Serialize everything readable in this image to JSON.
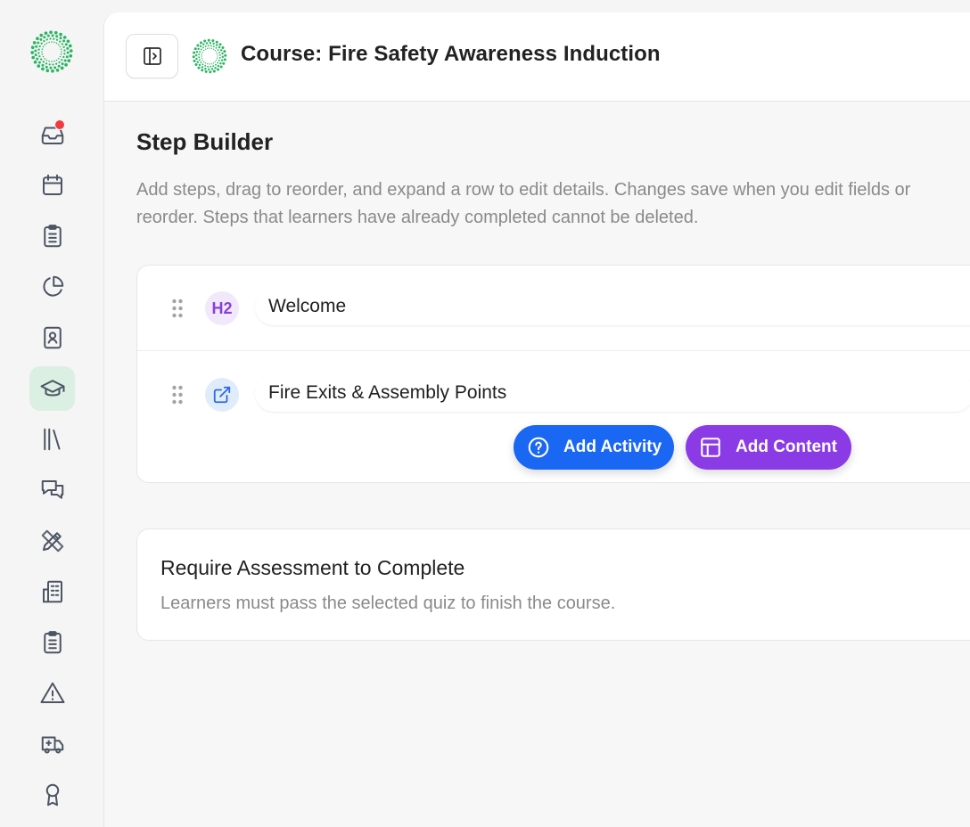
{
  "sidebar": {
    "logo": "sparkle-ring-logo",
    "items": [
      {
        "icon": "inbox-icon",
        "badge": true
      },
      {
        "icon": "calendar-icon"
      },
      {
        "icon": "clipboard-list-icon"
      },
      {
        "icon": "pie-chart-icon"
      },
      {
        "icon": "contact-book-icon"
      },
      {
        "icon": "graduation-cap-icon",
        "active": true
      },
      {
        "icon": "library-icon"
      },
      {
        "icon": "messages-icon"
      },
      {
        "icon": "pencil-ruler-icon"
      },
      {
        "icon": "building-icon"
      },
      {
        "icon": "clipboard-checklist-icon"
      },
      {
        "icon": "warning-triangle-icon"
      },
      {
        "icon": "ambulance-icon"
      },
      {
        "icon": "award-ribbon-icon"
      }
    ],
    "accent_color": "#22a55a",
    "badge_color": "#ef3b3b",
    "active_bg": "#dcefe3"
  },
  "header": {
    "title": "Course: Fire Safety Awareness Induction"
  },
  "step_builder": {
    "heading": "Step Builder",
    "description": "Add steps, drag to reorder, and expand a row to edit details. Changes save when you edit fields or reorder. Steps that learners have already completed cannot be deleted.",
    "steps": [
      {
        "icon": "heading-h2-icon",
        "icon_text": "H2",
        "title": "Welcome"
      },
      {
        "icon": "external-link-icon",
        "title": "Fire Exits & Assembly Points"
      }
    ],
    "add_activity_label": "Add Activity",
    "add_content_label": "Add Content",
    "activity_color": "#1a67f3",
    "content_color": "#8a3be6"
  },
  "assessment": {
    "title": "Require Assessment to Complete",
    "description": "Learners must pass the selected quiz to finish the course."
  }
}
